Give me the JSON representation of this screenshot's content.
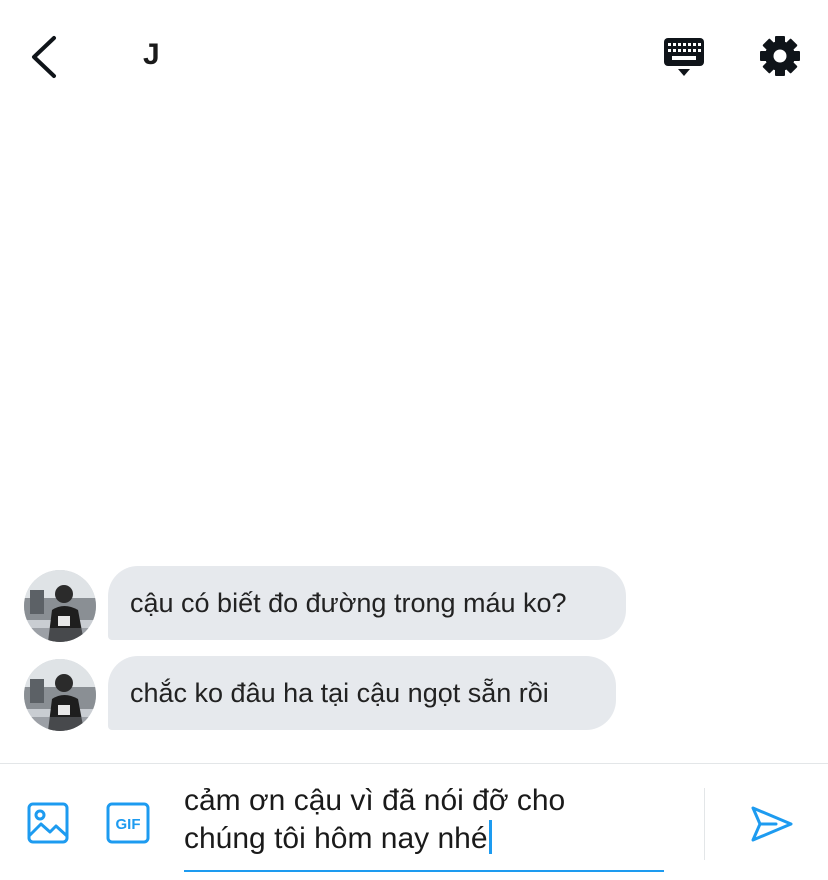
{
  "header": {
    "title": "J",
    "icons": {
      "back": "chevron-left-icon",
      "keyboard": "keyboard-icon",
      "settings": "gear-icon"
    }
  },
  "messages": [
    {
      "text": "cậu có biết đo đường trong máu ko?",
      "avatar": "avatar"
    },
    {
      "text": "chắc ko đâu ha tại cậu ngọt sẵn rồi",
      "avatar": "avatar"
    }
  ],
  "composer": {
    "value_line1": "cảm ơn cậu vì đã nói đỡ cho",
    "value_line2": "chúng tôi hôm nay nhé",
    "gif_label": "GIF",
    "icons": {
      "image": "image-icon",
      "gif": "gif-icon",
      "send": "send-icon"
    }
  },
  "colors": {
    "accent": "#1d9bf0",
    "bubble": "#e6e9ed",
    "text": "#0f1419"
  }
}
